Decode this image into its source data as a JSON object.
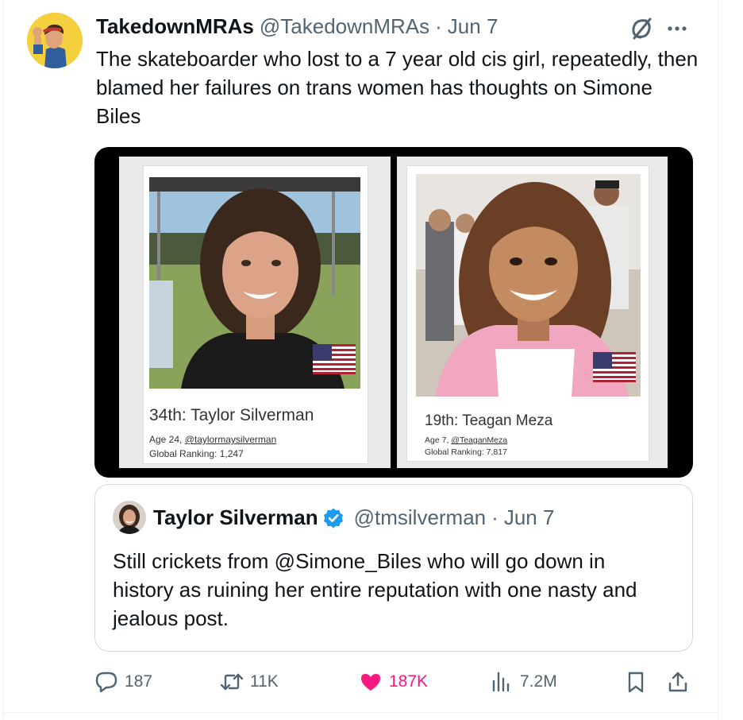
{
  "tweet": {
    "author_name": "TakedownMRAs",
    "author_handle": "@TakedownMRAs",
    "separator": "·",
    "date": "Jun 7",
    "text": "The skateboarder who lost to a 7 year old cis girl, repeatedly, then blamed her failures on trans women has thoughts on Simone Biles",
    "icons": [
      "grok-icon",
      "more-icon"
    ]
  },
  "media": {
    "cards": [
      {
        "rank_name": "34th: Taylor Silverman",
        "age_prefix": "Age 24, ",
        "profile_link": "@taylormaysilverman",
        "global_ranking": "Global Ranking: 1,247",
        "flag": "us-flag-icon"
      },
      {
        "rank_name": "19th: Teagan Meza",
        "age_prefix": "Age 7, ",
        "profile_link": "@TeaganMeza",
        "global_ranking": "Global Ranking: 7,817",
        "flag": "us-flag-icon"
      }
    ]
  },
  "quote": {
    "author_name": "Taylor Silverman",
    "verified": true,
    "author_handle": "@tmsilverman",
    "separator": "·",
    "date": "Jun 7",
    "text": "Still crickets from @Simone_Biles who will go down in history as ruining her entire reputation with one nasty and jealous post."
  },
  "actions": {
    "replies": "187",
    "retweets": "11K",
    "likes": "187K",
    "views": "7.2M",
    "liked": true,
    "colors": {
      "like": "#f91880",
      "muted": "#536471",
      "verified": "#1d9bf0"
    }
  }
}
